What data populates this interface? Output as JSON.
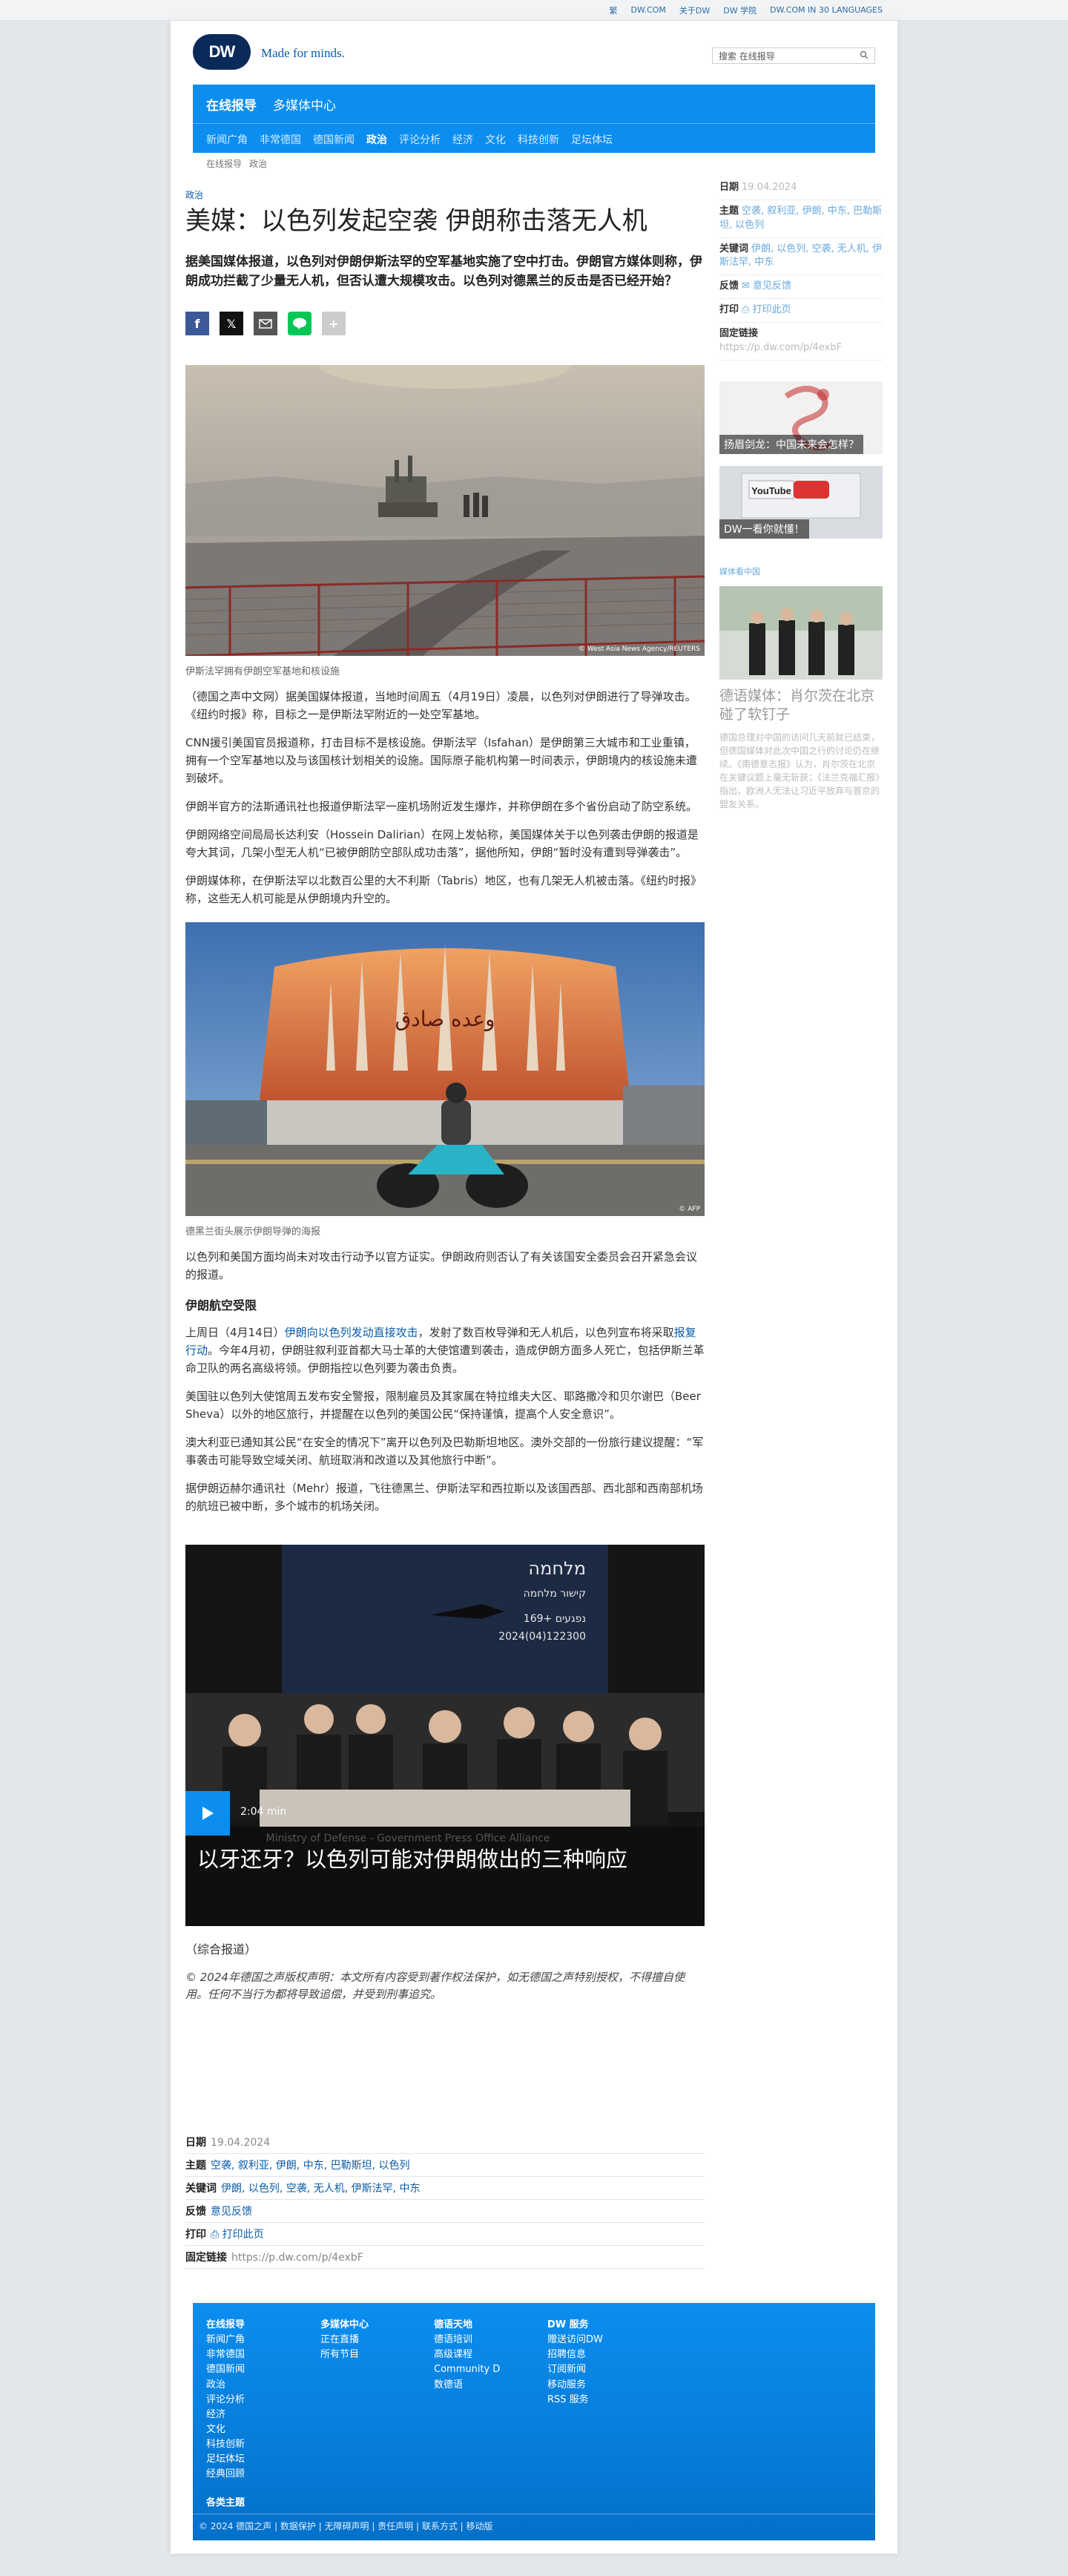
{
  "topbar": {
    "items": [
      "繁",
      "DW.COM",
      "关于DW",
      "DW 学院",
      "DW.COM IN 30 LANGUAGES"
    ]
  },
  "header": {
    "logo": "DW",
    "slogan": "Made for minds.",
    "search_placeholder": "搜索 在线报导"
  },
  "nav": {
    "sections": [
      "在线报导",
      "多媒体中心"
    ],
    "subnav": [
      "新闻广角",
      "非常德国",
      "德国新闻",
      "政治",
      "评论分析",
      "经济",
      "文化",
      "科技创新",
      "足坛体坛"
    ],
    "active_sub": "政治"
  },
  "breadcrumb": [
    "在线报导",
    "政治"
  ],
  "article": {
    "kicker": "政治",
    "title": "美媒：以色列发起空袭 伊朗称击落无人机",
    "lead": "据美国媒体报道，以色列对伊朗伊斯法罕的空军基地实施了空中打击。伊朗官方媒体则称，伊朗成功拦截了少量无人机，但否认遭大规模攻击。以色列对德黑兰的反击是否已经开始？",
    "image1": {
      "caption": "伊斯法罕拥有伊朗空军基地和核设施",
      "credit": "© West Asia News Agency/REUTERS"
    },
    "paras1": [
      "（德国之声中文网）据美国媒体报道，当地时间周五（4月19日）凌晨，以色列对伊朗进行了导弹攻击。《纽约时报》称，目标之一是伊斯法罕附近的一处空军基地。",
      "CNN援引美国官员报道称，打击目标不是核设施。伊斯法罕（Isfahan）是伊朗第三大城市和工业重镇，拥有一个空军基地以及与该国核计划相关的设施。国际原子能机构第一时间表示，伊朗境内的核设施未遭到破坏。",
      "伊朗半官方的法斯通讯社也报道伊斯法罕一座机场附近发生爆炸，并称伊朗在多个省份启动了防空系统。",
      "伊朗网络空间局局长达利安（Hossein Dalirian）在网上发帖称，美国媒体关于以色列袭击伊朗的报道是夸大其词，几架小型无人机“已被伊朗防空部队成功击落”，据他所知，伊朗“暂时没有遭到导弹袭击”。",
      "伊朗媒体称，在伊斯法罕以北数百公里的大不利斯（Tabris）地区，也有几架无人机被击落。《纽约时报》称，这些无人机可能是从伊朗境内升空的。"
    ],
    "image2": {
      "caption": "德黑兰街头展示伊朗导弹的海报",
      "credit": "© AFP",
      "billboard": "وعده صادق"
    },
    "para_after2": "以色列和美国方面均尚未对攻击行动予以官方证实。伊朗政府则否认了有关该国安全委员会召开紧急会议的报道。",
    "subhead": "伊朗航空受限",
    "para_link": {
      "pre": "上周日（4月14日）",
      "link1": "伊朗向以色列发动直接攻击",
      "mid": "，发射了数百枚导弹和无人机后，以色列宣布将采取",
      "link2": "报复行动",
      "post": "。今年4月初，伊朗驻叙利亚首都大马士革的大使馆遭到袭击，造成伊朗方面多人死亡，包括伊斯兰革命卫队的两名高级将领。伊朗指控以色列要为袭击负责。"
    },
    "paras2": [
      "美国驻以色列大使馆周五发布安全警报，限制雇员及其家属在特拉维夫大区、耶路撒冷和贝尔谢巴（Beer Sheva）以外的地区旅行，并提醒在以色列的美国公民“保持谨慎，提高个人安全意识”。",
      "澳大利亚已通知其公民“在安全的情况下”离开以色列及巴勒斯坦地区。澳外交部的一份旅行建议提醒：“军事袭击可能导致空域关闭、航班取消和改道以及其他旅行中断”。",
      "据伊朗迈赫尔通讯社（Mehr）报道，飞往德黑兰、伊斯法罕和西拉斯以及该国西部、西北部和西南部机场的航班已被中断，多个城市的机场关闭。"
    ],
    "video": {
      "title": "以牙还牙？以色列可能对伊朗做出的三种响应",
      "duration": "2:04 min",
      "screen_lines": [
        "מלחמה",
        "קישור מלחמה",
        "169+ נפגעים",
        "2024(04)122300"
      ],
      "watermark": "Ministry of Defense - Government Press Office Alliance"
    },
    "source": "（综合报道）",
    "copyright": "© 2024年德国之声版权声明：本文所有内容受到著作权法保护，如无德国之声特别授权，不得擅自使用。任何不当行为都将导致追偿，并受到刑事追究。"
  },
  "meta": {
    "date_label": "日期",
    "date": "19.04.2024",
    "topics_label": "主题",
    "topics": "空袭, 叙利亚, 伊朗, 中东, 巴勒斯坦, 以色列",
    "keywords_label": "关键词",
    "keywords": "伊朗, 以色列, 空袭, 无人机, 伊斯法罕, 中东",
    "feedback_label": "反馈",
    "feedback": "意见反馈",
    "print_label": "打印",
    "print": "打印此页",
    "link_label": "固定链接",
    "link": "https://p.dw.com/p/4exbF"
  },
  "sidebar": {
    "topics": "空袭, 叙利亚, 伊朗, 中东, 巴勒斯坦, 以色列",
    "keywords": "伊朗, 以色列, 空袭, 无人机, 伊斯法罕, 中东",
    "teaser1": "扬眉剑龙：中国未来会怎样？",
    "teaser2": "DW一看你就懂！",
    "teaser2_logo": "YouTube",
    "section": "媒体看中国",
    "big_title": "德语媒体：肖尔茨在北京碰了软钉子",
    "small_text": "德国总理对中国的访问几天前就已结束，但德国媒体对此次中国之行的讨论仍在继续。《南德意志报》认为，肖尔茨在北京在关键议题上毫无斩获；《法兰克福汇报》指出，欧洲人无法让习近平放弃与普京的盟友关系。"
  },
  "footer": {
    "col1": {
      "head": "在线报导",
      "items": [
        "新闻广角",
        "非常德国",
        "德国新闻",
        "政治",
        "评论分析",
        "经济",
        "文化",
        "科技创新",
        "足坛体坛",
        "经典回顾"
      ]
    },
    "col2": {
      "head": "多媒体中心",
      "items": [
        "正在直播",
        "所有节目"
      ]
    },
    "col3": {
      "head": "德语天地",
      "items": [
        "德语培训",
        "高级课程",
        "Community D",
        "数德语"
      ]
    },
    "col4": {
      "head": "DW 服务",
      "items": [
        "赠送访问DW",
        "招聘信息",
        "订阅新闻",
        "移动服务",
        "RSS 服务"
      ]
    },
    "topics": "各类主题",
    "legal": "© 2024 德国之声 | 数据保护 | 无障碍声明 | 责任声明 | 联系方式 | 移动版"
  }
}
